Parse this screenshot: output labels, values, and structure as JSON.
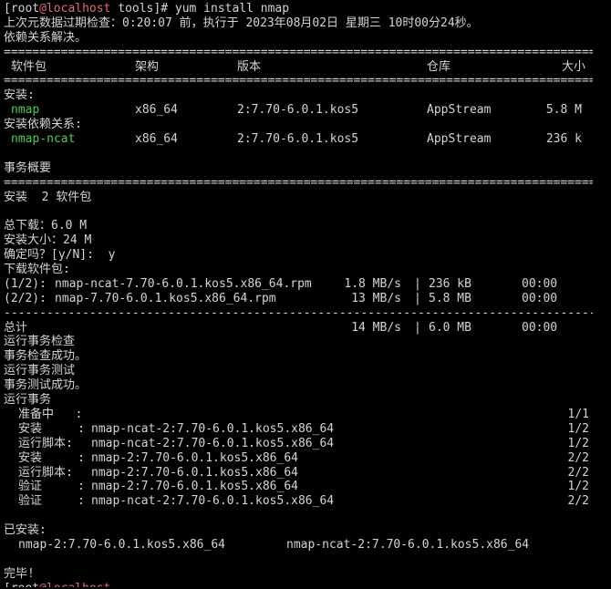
{
  "prompt": {
    "open": "[",
    "user": "root",
    "at": "@",
    "host": "localhost",
    "path_and_cmd": " tools]# yum install nmap"
  },
  "meta_check": "上次元数据过期检查：0:20:07 前，执行于 2023年08月02日 星期三 10时00分24秒。",
  "deps_resolved": "依赖关系解决。",
  "rule_double": "==============================================================================================",
  "rule_single": "----------------------------------------------------------------------------------------------",
  "table_headers": {
    "package": "软件包",
    "arch": "架构",
    "version": "版本",
    "repo": "仓库",
    "size": "大小"
  },
  "install_label": "安装:",
  "install_pkgs": [
    {
      "name": "nmap",
      "arch": "x86_64",
      "version": "2:7.70-6.0.1.kos5",
      "repo": "AppStream",
      "size": "5.8 M"
    }
  ],
  "deps_label": "安装依赖关系:",
  "dep_pkgs": [
    {
      "name": "nmap-ncat",
      "arch": "x86_64",
      "version": "2:7.70-6.0.1.kos5",
      "repo": "AppStream",
      "size": "236 k"
    }
  ],
  "summary_title": "事务概要",
  "install_count": "安装  2 软件包",
  "total_download": "总下载：6.0 M",
  "install_size": "安装大小：24 M",
  "confirm": {
    "prompt": "确定吗？[y/N]: ",
    "answer": " y"
  },
  "downloading": "下载软件包:",
  "downloads": [
    {
      "idx": "(1/2):",
      "file": "nmap-ncat-7.70-6.0.1.kos5.x86_64.rpm",
      "speed": "1.8 MB/s",
      "size": "236 kB",
      "time": "00:00"
    },
    {
      "idx": "(2/2):",
      "file": "nmap-7.70-6.0.1.kos5.x86_64.rpm",
      "speed": "13 MB/s",
      "size": "5.8 MB",
      "time": "00:00"
    }
  ],
  "total_line": {
    "label": "总计",
    "speed": "14 MB/s",
    "size": "6.0 MB",
    "time": "00:00"
  },
  "txn_messages": [
    "运行事务检查",
    "事务检查成功。",
    "运行事务测试",
    "事务测试成功。",
    "运行事务"
  ],
  "txn_steps": [
    {
      "action": "准备中   :",
      "pkg": "",
      "progress": "1/1"
    },
    {
      "action": "安装     :",
      "pkg": "nmap-ncat-2:7.70-6.0.1.kos5.x86_64",
      "progress": "1/2"
    },
    {
      "action": "运行脚本:",
      "pkg": "nmap-ncat-2:7.70-6.0.1.kos5.x86_64",
      "progress": "1/2"
    },
    {
      "action": "安装     :",
      "pkg": "nmap-2:7.70-6.0.1.kos5.x86_64",
      "progress": "2/2"
    },
    {
      "action": "运行脚本:",
      "pkg": "nmap-2:7.70-6.0.1.kos5.x86_64",
      "progress": "2/2"
    },
    {
      "action": "验证     :",
      "pkg": "nmap-2:7.70-6.0.1.kos5.x86_64",
      "progress": "1/2"
    },
    {
      "action": "验证     :",
      "pkg": "nmap-ncat-2:7.70-6.0.1.kos5.x86_64",
      "progress": "2/2"
    }
  ],
  "installed_label": "已安装:",
  "installed_pkgs": [
    "nmap-2:7.70-6.0.1.kos5.x86_64",
    "nmap-ncat-2:7.70-6.0.1.kos5.x86_64"
  ],
  "complete": "完毕!",
  "colors": {
    "background": "#000000",
    "text": "#d4d4d4",
    "host": "#e06c75",
    "package": "#4ec94e"
  }
}
